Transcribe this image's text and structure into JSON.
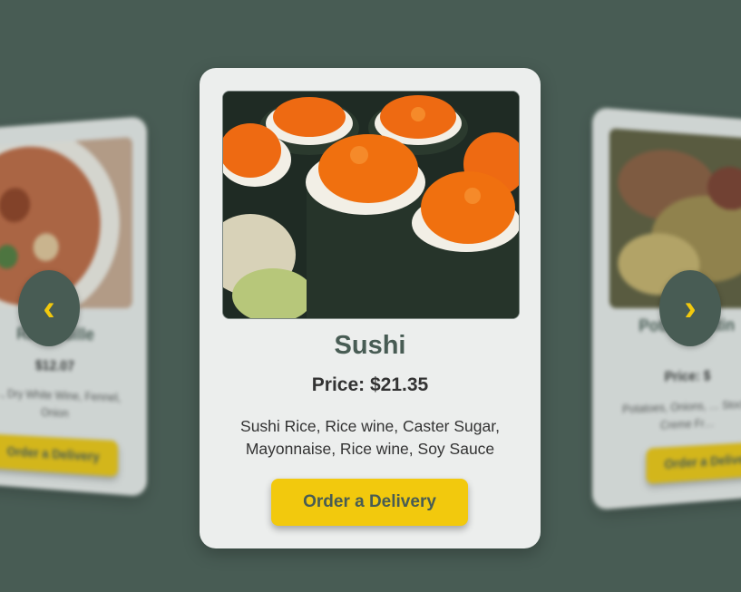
{
  "carousel": {
    "prev_icon": "‹",
    "next_icon": "›",
    "left_card": {
      "title": "Ratatouille",
      "price": "$12.07",
      "ingredients": "…, Dry White Wine, Fennel, Onion",
      "button": "Order a Delivery"
    },
    "center_card": {
      "title": "Sushi",
      "price": "Price: $21.35",
      "ingredients": "Sushi Rice, Rice wine, Caster Sugar, Mayonnaise, Rice wine, Soy Sauce",
      "button": "Order a Delivery"
    },
    "right_card": {
      "title": "Potato Gratin",
      "price": "Price: $",
      "ingredients": "Potatoes, Onions, … Stock, Creme Fr…",
      "button": "Order a Delivery"
    }
  },
  "colors": {
    "background": "#485c54",
    "card": "#eceeed",
    "accent": "#f2c90d",
    "title": "#485c54"
  }
}
